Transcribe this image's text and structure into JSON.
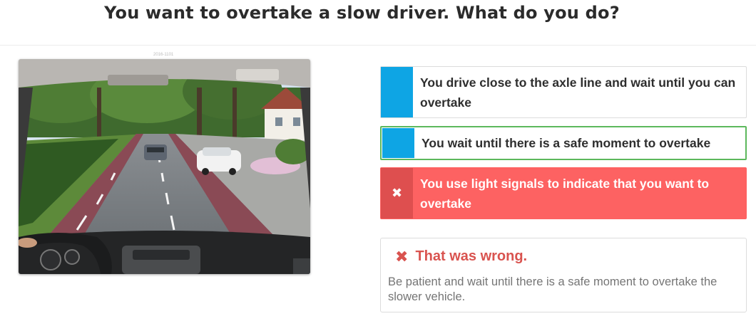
{
  "question": {
    "title": "You want to overtake a slow driver. What do you do?",
    "image_caption": "2016-1101"
  },
  "answers": [
    {
      "text": "You drive close to the axle line and wait until you can overtake",
      "state": "neutral",
      "marker": ""
    },
    {
      "text": "You wait until there is a safe moment to overtake",
      "state": "correct",
      "marker": ""
    },
    {
      "text": "You use light signals to indicate that you want to overtake",
      "state": "selected-wrong",
      "marker": "✖"
    }
  ],
  "feedback": {
    "icon": "close-icon",
    "title": "That was wrong.",
    "message": "Be patient and wait until there is a safe moment to overtake the slower vehicle."
  },
  "colors": {
    "accent_blue": "#0ea5e4",
    "correct_border": "#5cb85c",
    "wrong_bg": "#fd6262",
    "wrong_marker": "#de4f4f",
    "feedback_red": "#d9534f"
  }
}
